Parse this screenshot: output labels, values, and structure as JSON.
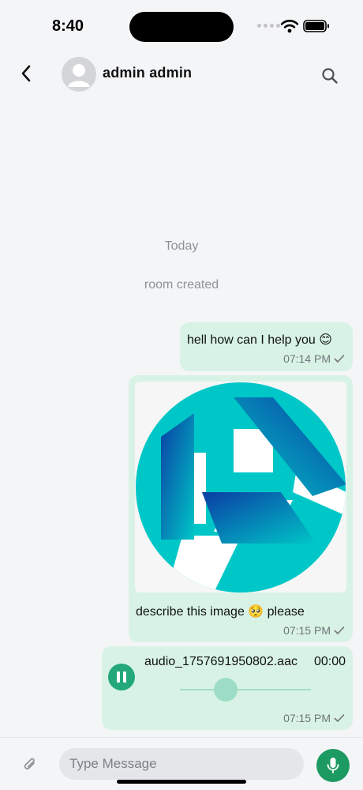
{
  "status_bar": {
    "time": "8:40",
    "icons": [
      "signal-dots-icon",
      "wifi-icon",
      "battery-icon"
    ]
  },
  "header": {
    "contact_name": "admin admin",
    "icons": [
      "back-arrow-icon",
      "avatar-placeholder-icon",
      "search-icon"
    ]
  },
  "conversation": {
    "date_separator": "Today",
    "system_message": "room created",
    "messages": [
      {
        "type": "text",
        "text": "hell how can I help you 😊",
        "time": "07:14 PM",
        "status_icon": "check-icon"
      },
      {
        "type": "image",
        "image_icon": "hexagonal-logo-image",
        "caption": "describe this image 🥺  please",
        "time": "07:15 PM",
        "status_icon": "check-icon"
      },
      {
        "type": "audio",
        "file_name": "audio_1757691950802.aac",
        "duration": "00:00",
        "progress": 0.35,
        "state_icon": "pause-icon",
        "time": "07:15 PM",
        "status_icon": "check-icon"
      }
    ]
  },
  "composer": {
    "placeholder": "Type Message",
    "value": "",
    "icons": [
      "paperclip-icon",
      "microphone-icon"
    ]
  },
  "colors": {
    "background": "#f4f5f7",
    "outgoing_bubble": "#d8f3e6",
    "accent_green": "#1c9a62",
    "logo_cyan": "#00c7c7",
    "logo_blue": "#0a3da4"
  }
}
